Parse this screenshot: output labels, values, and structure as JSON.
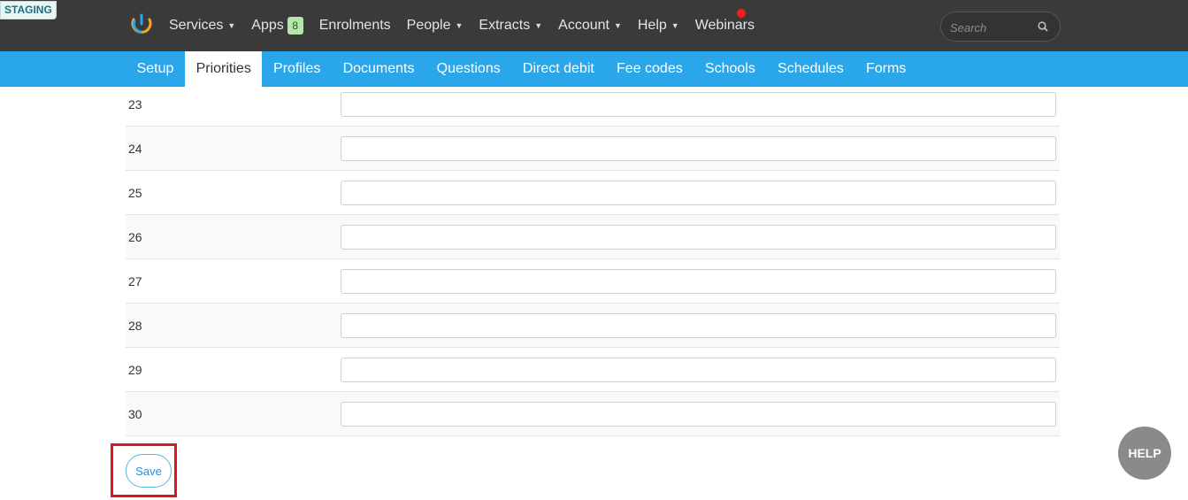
{
  "env_badge": "STAGING",
  "nav": {
    "items": [
      {
        "label": "Services",
        "dropdown": true
      },
      {
        "label": "Apps",
        "badge": "8"
      },
      {
        "label": "Enrolments"
      },
      {
        "label": "People",
        "dropdown": true
      },
      {
        "label": "Extracts",
        "dropdown": true
      },
      {
        "label": "Account",
        "dropdown": true
      },
      {
        "label": "Help",
        "dropdown": true
      },
      {
        "label": "Webinars"
      }
    ],
    "caret": "▼",
    "search_placeholder": "Search"
  },
  "subnav": {
    "items": [
      "Setup",
      "Priorities",
      "Profiles",
      "Documents",
      "Questions",
      "Direct debit",
      "Fee codes",
      "Schools",
      "Schedules",
      "Forms"
    ],
    "active": "Priorities"
  },
  "rows": [
    {
      "number": "23",
      "value": ""
    },
    {
      "number": "24",
      "value": ""
    },
    {
      "number": "25",
      "value": ""
    },
    {
      "number": "26",
      "value": ""
    },
    {
      "number": "27",
      "value": ""
    },
    {
      "number": "28",
      "value": ""
    },
    {
      "number": "29",
      "value": ""
    },
    {
      "number": "30",
      "value": ""
    }
  ],
  "save_label": "Save",
  "help_label": "HELP",
  "colors": {
    "topbar": "#3a3a3a",
    "subbar": "#2aa6ea",
    "notification": "#ff1a1a",
    "highlight": "#e0141c"
  }
}
